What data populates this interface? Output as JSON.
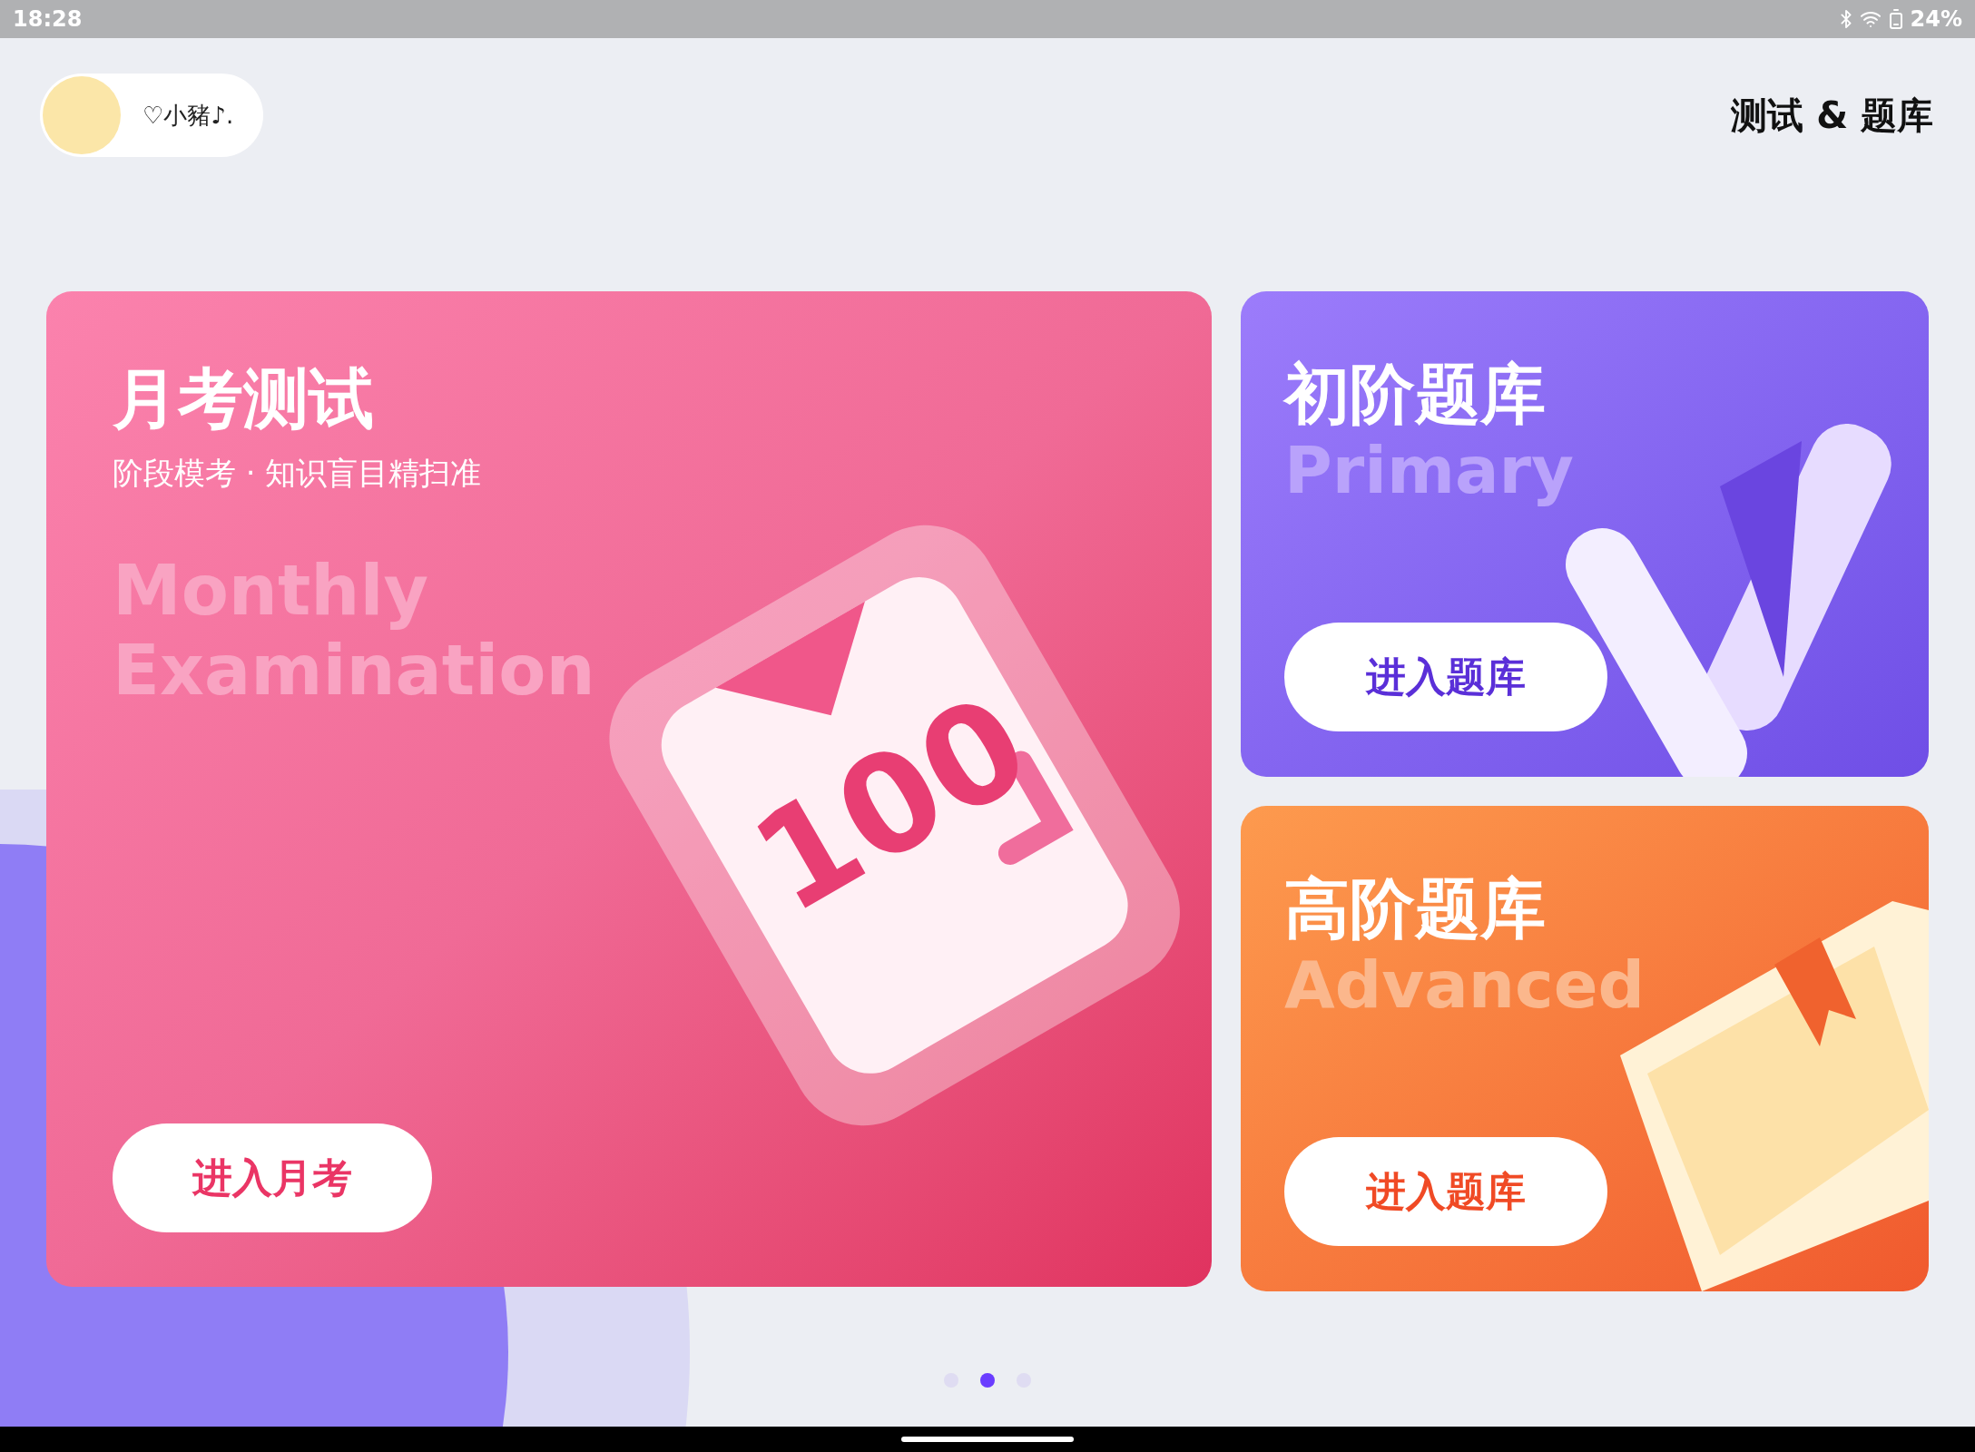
{
  "status_bar": {
    "time": "18:28",
    "battery": "24%"
  },
  "profile": {
    "name": "♡小豬♪."
  },
  "page_title": "测试 & 题库",
  "cards": [
    {
      "kind": "monthly",
      "title": "月考测试",
      "subtitle": "阶段模考 · 知识盲目精扫准",
      "english": "Monthly Examination",
      "badge": "100",
      "button": "进入月考"
    },
    {
      "kind": "primary",
      "title": "初阶题库",
      "english": "Primary",
      "button": "进入题库"
    },
    {
      "kind": "advanced",
      "title": "高阶题库",
      "english": "Advanced",
      "button": "进入题库"
    }
  ],
  "pager": [
    {
      "selected": false
    },
    {
      "selected": true
    },
    {
      "selected": false
    }
  ]
}
